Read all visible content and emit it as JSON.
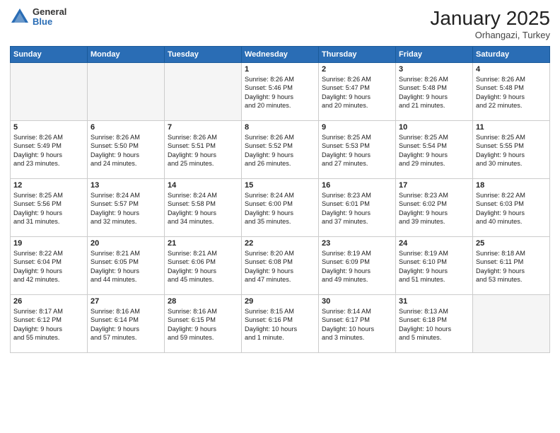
{
  "logo": {
    "general": "General",
    "blue": "Blue"
  },
  "header": {
    "month": "January 2025",
    "location": "Orhangazi, Turkey"
  },
  "days_of_week": [
    "Sunday",
    "Monday",
    "Tuesday",
    "Wednesday",
    "Thursday",
    "Friday",
    "Saturday"
  ],
  "weeks": [
    [
      {
        "day": "",
        "text": ""
      },
      {
        "day": "",
        "text": ""
      },
      {
        "day": "",
        "text": ""
      },
      {
        "day": "1",
        "text": "Sunrise: 8:26 AM\nSunset: 5:46 PM\nDaylight: 9 hours\nand 20 minutes."
      },
      {
        "day": "2",
        "text": "Sunrise: 8:26 AM\nSunset: 5:47 PM\nDaylight: 9 hours\nand 20 minutes."
      },
      {
        "day": "3",
        "text": "Sunrise: 8:26 AM\nSunset: 5:48 PM\nDaylight: 9 hours\nand 21 minutes."
      },
      {
        "day": "4",
        "text": "Sunrise: 8:26 AM\nSunset: 5:48 PM\nDaylight: 9 hours\nand 22 minutes."
      }
    ],
    [
      {
        "day": "5",
        "text": "Sunrise: 8:26 AM\nSunset: 5:49 PM\nDaylight: 9 hours\nand 23 minutes."
      },
      {
        "day": "6",
        "text": "Sunrise: 8:26 AM\nSunset: 5:50 PM\nDaylight: 9 hours\nand 24 minutes."
      },
      {
        "day": "7",
        "text": "Sunrise: 8:26 AM\nSunset: 5:51 PM\nDaylight: 9 hours\nand 25 minutes."
      },
      {
        "day": "8",
        "text": "Sunrise: 8:26 AM\nSunset: 5:52 PM\nDaylight: 9 hours\nand 26 minutes."
      },
      {
        "day": "9",
        "text": "Sunrise: 8:25 AM\nSunset: 5:53 PM\nDaylight: 9 hours\nand 27 minutes."
      },
      {
        "day": "10",
        "text": "Sunrise: 8:25 AM\nSunset: 5:54 PM\nDaylight: 9 hours\nand 29 minutes."
      },
      {
        "day": "11",
        "text": "Sunrise: 8:25 AM\nSunset: 5:55 PM\nDaylight: 9 hours\nand 30 minutes."
      }
    ],
    [
      {
        "day": "12",
        "text": "Sunrise: 8:25 AM\nSunset: 5:56 PM\nDaylight: 9 hours\nand 31 minutes."
      },
      {
        "day": "13",
        "text": "Sunrise: 8:24 AM\nSunset: 5:57 PM\nDaylight: 9 hours\nand 32 minutes."
      },
      {
        "day": "14",
        "text": "Sunrise: 8:24 AM\nSunset: 5:58 PM\nDaylight: 9 hours\nand 34 minutes."
      },
      {
        "day": "15",
        "text": "Sunrise: 8:24 AM\nSunset: 6:00 PM\nDaylight: 9 hours\nand 35 minutes."
      },
      {
        "day": "16",
        "text": "Sunrise: 8:23 AM\nSunset: 6:01 PM\nDaylight: 9 hours\nand 37 minutes."
      },
      {
        "day": "17",
        "text": "Sunrise: 8:23 AM\nSunset: 6:02 PM\nDaylight: 9 hours\nand 39 minutes."
      },
      {
        "day": "18",
        "text": "Sunrise: 8:22 AM\nSunset: 6:03 PM\nDaylight: 9 hours\nand 40 minutes."
      }
    ],
    [
      {
        "day": "19",
        "text": "Sunrise: 8:22 AM\nSunset: 6:04 PM\nDaylight: 9 hours\nand 42 minutes."
      },
      {
        "day": "20",
        "text": "Sunrise: 8:21 AM\nSunset: 6:05 PM\nDaylight: 9 hours\nand 44 minutes."
      },
      {
        "day": "21",
        "text": "Sunrise: 8:21 AM\nSunset: 6:06 PM\nDaylight: 9 hours\nand 45 minutes."
      },
      {
        "day": "22",
        "text": "Sunrise: 8:20 AM\nSunset: 6:08 PM\nDaylight: 9 hours\nand 47 minutes."
      },
      {
        "day": "23",
        "text": "Sunrise: 8:19 AM\nSunset: 6:09 PM\nDaylight: 9 hours\nand 49 minutes."
      },
      {
        "day": "24",
        "text": "Sunrise: 8:19 AM\nSunset: 6:10 PM\nDaylight: 9 hours\nand 51 minutes."
      },
      {
        "day": "25",
        "text": "Sunrise: 8:18 AM\nSunset: 6:11 PM\nDaylight: 9 hours\nand 53 minutes."
      }
    ],
    [
      {
        "day": "26",
        "text": "Sunrise: 8:17 AM\nSunset: 6:12 PM\nDaylight: 9 hours\nand 55 minutes."
      },
      {
        "day": "27",
        "text": "Sunrise: 8:16 AM\nSunset: 6:14 PM\nDaylight: 9 hours\nand 57 minutes."
      },
      {
        "day": "28",
        "text": "Sunrise: 8:16 AM\nSunset: 6:15 PM\nDaylight: 9 hours\nand 59 minutes."
      },
      {
        "day": "29",
        "text": "Sunrise: 8:15 AM\nSunset: 6:16 PM\nDaylight: 10 hours\nand 1 minute."
      },
      {
        "day": "30",
        "text": "Sunrise: 8:14 AM\nSunset: 6:17 PM\nDaylight: 10 hours\nand 3 minutes."
      },
      {
        "day": "31",
        "text": "Sunrise: 8:13 AM\nSunset: 6:18 PM\nDaylight: 10 hours\nand 5 minutes."
      },
      {
        "day": "",
        "text": ""
      }
    ]
  ]
}
